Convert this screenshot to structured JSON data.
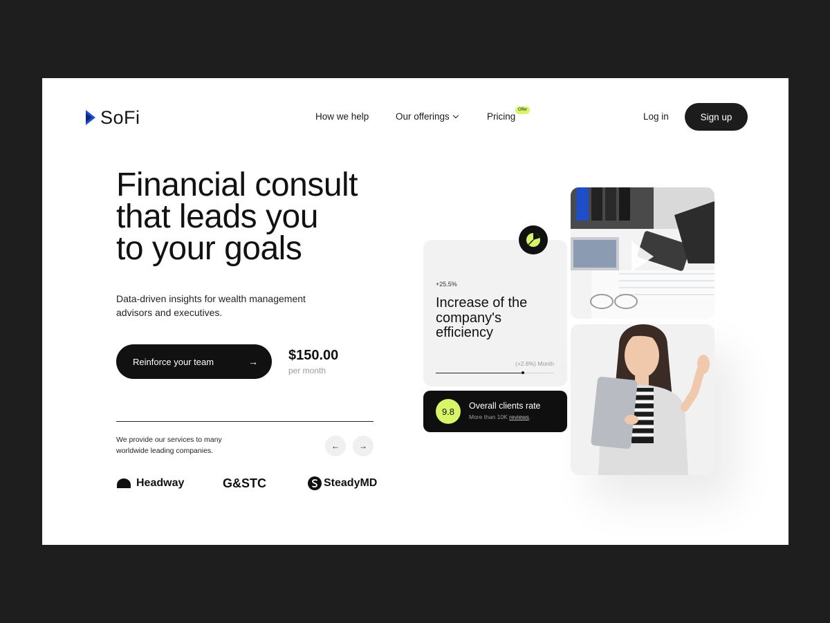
{
  "header": {
    "logo_text": "SoFi",
    "nav": {
      "how_we_help": "How we help",
      "our_offerings": "Our offerings",
      "pricing": "Pricing",
      "pricing_badge": "Offer"
    },
    "login": "Log in",
    "signup": "Sign up"
  },
  "hero": {
    "headline_line1": "Financial consult",
    "headline_line2_pre": "that ",
    "headline_line2_highlight": "leads",
    "headline_line2_post": " you",
    "headline_line3": "to your goals",
    "subtitle": "Data-driven insights for wealth management advisors and executives.",
    "cta_label": "Reinforce your team",
    "price": "$150.00",
    "price_period": "per month",
    "services_text": "We provide our services to many worldwide leading companies.",
    "partners": [
      "Headway",
      "G&STC",
      "SteadyMD"
    ]
  },
  "stat_card": {
    "delta": "+25.5%",
    "title": "Increase of the company's efficiency",
    "month_label": "(+2.8%) Month",
    "progress": 0.74
  },
  "rate_card": {
    "score": "9.8",
    "title": "Overall clients rate",
    "sub_pre": "More than 10K ",
    "sub_link": "reviews",
    "sub_post": "."
  },
  "colors": {
    "accent": "#d8f56a",
    "dark": "#111111",
    "logo_blue": "#1f4fd6",
    "background": "#1e1e1e"
  }
}
